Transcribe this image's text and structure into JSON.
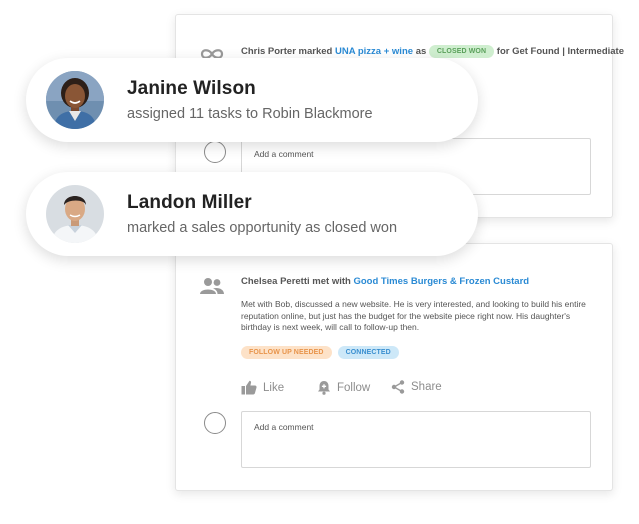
{
  "feed": {
    "deal_activity": {
      "actor": "Chris Porter",
      "verb": "marked",
      "deal": "UNA pizza + wine",
      "as": "as",
      "status_badge": "CLOSED WON",
      "suffix": "for Get Found | Intermediate",
      "comment_placeholder": "Add a comment"
    },
    "meeting_activity": {
      "actor": "Chelsea Peretti",
      "verb": "met with",
      "company": "Good Times Burgers & Frozen Custard",
      "note": "Met with Bob, discussed a new website. He is very interested, and looking to build his entire reputation online, but just has the budget for the website piece right now. His daughter's birthday is next week, will call to follow-up then.",
      "tags": [
        "FOLLOW UP NEEDED",
        "CONNECTED"
      ],
      "actions": {
        "like": "Like",
        "follow": "Follow",
        "share": "Share"
      },
      "comment_placeholder": "Add a comment"
    }
  },
  "notifications": [
    {
      "name": "Janine Wilson",
      "text": "assigned 11 tasks to Robin Blackmore"
    },
    {
      "name": "Landon Miller",
      "text": "marked a sales opportunity as closed won"
    }
  ],
  "colors": {
    "link": "#2a8ad4",
    "badge_closed_won": "#cfeecf",
    "badge_follow_up": "#fde2c8",
    "badge_connected": "#cde8f8"
  },
  "icons": {
    "deal_activity": "infinity-icon",
    "meeting_activity": "people-icon",
    "like": "thumbs-up-icon",
    "follow": "bell-add-icon",
    "share": "share-icon"
  }
}
